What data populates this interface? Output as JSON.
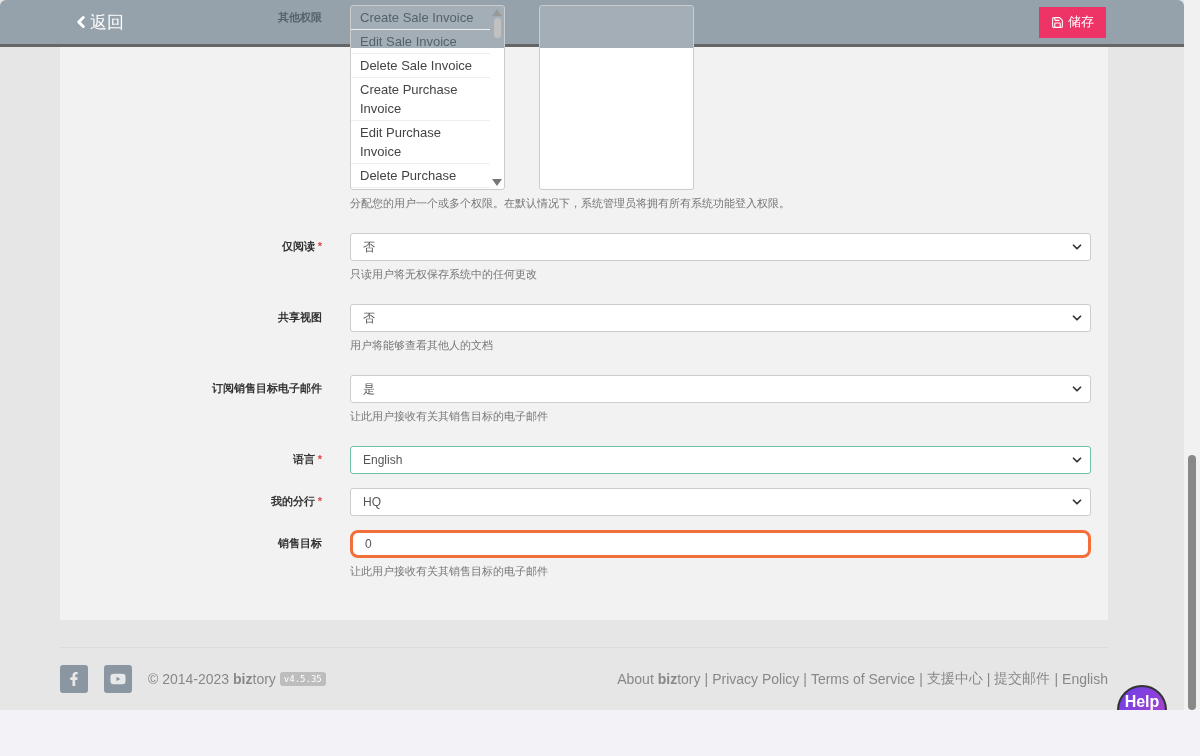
{
  "header": {
    "back": "返回",
    "save": "储存"
  },
  "permissions": {
    "label": "其他权限",
    "items": [
      {
        "label": "Create Sale Invoice"
      },
      {
        "label": "Edit Sale Invoice"
      },
      {
        "label": "Delete Sale Invoice"
      },
      {
        "label": "Create Purchase Invoice"
      },
      {
        "label": "Edit Purchase Invoice"
      },
      {
        "label": "Delete Purchase"
      }
    ],
    "hint": "分配您的用户一个或多个权限。在默认情况下，系统管理员将拥有所有系统功能登入权限。"
  },
  "fields": [
    {
      "label": "仅阅读",
      "required": true,
      "kind": "select",
      "value": "否",
      "focused": false,
      "highlighted": false,
      "hint": "只读用户将无权保存系统中的任何更改"
    },
    {
      "label": "共享视图",
      "required": false,
      "kind": "select",
      "value": "否",
      "focused": false,
      "highlighted": false,
      "hint": "用户将能够查看其他人的文档"
    },
    {
      "label": "订阅销售目标电子邮件",
      "required": false,
      "kind": "select",
      "value": "是",
      "focused": false,
      "highlighted": false,
      "hint": "让此用户接收有关其销售目标的电子邮件"
    },
    {
      "label": "语言",
      "required": true,
      "kind": "select",
      "value": "English",
      "focused": true,
      "highlighted": false
    },
    {
      "label": "我的分行",
      "required": true,
      "kind": "select",
      "value": "HQ",
      "focused": false,
      "highlighted": false
    },
    {
      "label": "销售目标",
      "required": false,
      "kind": "input",
      "value": "0",
      "focused": false,
      "highlighted": true,
      "hint": "让此用户接收有关其销售目标的电子邮件"
    }
  ],
  "footer": {
    "copyright": "© 2014-2023 **biz**tory",
    "version": "v4.5.35",
    "separator": "|",
    "links": [
      "About **biz**tory",
      "Privacy Policy",
      "Terms of Service",
      "支援中心",
      "提交邮件",
      "English"
    ]
  },
  "required_mark": "*",
  "help": "Help"
}
